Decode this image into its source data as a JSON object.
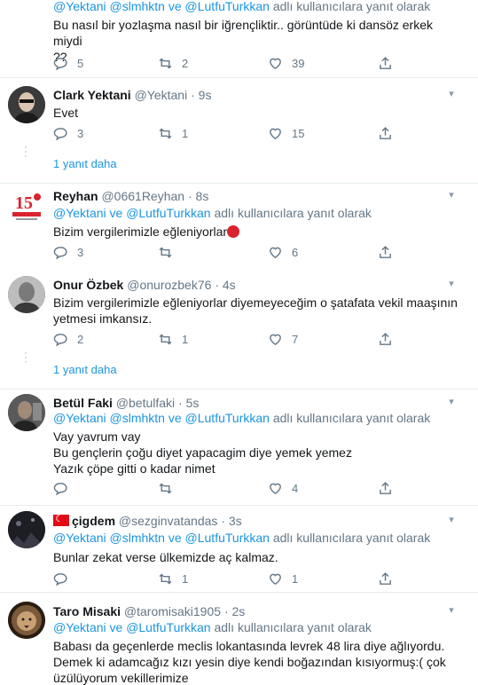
{
  "tweets": [
    {
      "reply_users": "@Yektani @slmhktn ve @LutfuTurkkan",
      "reply_suffix": "adlı kullanıcılara yanıt olarak",
      "text_lines": [
        "Bu nasıl bir yozlaşma nasıl bir iğrençliktir.. görüntüde ki dansöz erkek miydi",
        "??"
      ],
      "replies": "5",
      "retweets": "2",
      "likes": "39"
    },
    {
      "name": "Clark Yektani",
      "handle": "@Yektani",
      "time": "9s",
      "text_lines": [
        "Evet"
      ],
      "replies": "3",
      "retweets": "1",
      "likes": "15",
      "more_replies": "1 yanıt daha"
    },
    {
      "name": "Reyhan",
      "handle": "@0661Reyhan",
      "time": "8s",
      "reply_users": "@Yektani ve @LutfuTurkkan",
      "reply_suffix": "adlı kullanıcılara yanıt olarak",
      "text_lines": [
        "Bizim vergilerimizle eğleniyorlar"
      ],
      "replies": "3",
      "retweets": "",
      "likes": "6"
    },
    {
      "name": "Onur Özbek",
      "handle": "@onurozbek76",
      "time": "4s",
      "text_lines": [
        "Bizim vergilerimizle eğleniyorlar diyemeyeceğim o şatafata vekil maaşının",
        "yetmesi imkansız."
      ],
      "replies": "2",
      "retweets": "1",
      "likes": "7",
      "more_replies": "1 yanıt daha"
    },
    {
      "name": "Betül Faki",
      "handle": "@betulfaki",
      "time": "5s",
      "reply_users": "@Yektani @slmhktn ve @LutfuTurkkan",
      "reply_suffix": "adlı kullanıcılara yanıt olarak",
      "text_lines": [
        "Vay yavrum vay",
        "Bu gençlerin çoğu  diyet yapacagim diye yemek yemez",
        "Yazık çöpe gitti o kadar nimet"
      ],
      "replies": "",
      "retweets": "",
      "likes": "4"
    },
    {
      "name": "çigdem",
      "handle": "@sezginvatandas",
      "time": "3s",
      "reply_users": "@Yektani @slmhktn ve @LutfuTurkkan",
      "reply_suffix": "adlı kullanıcılara yanıt olarak",
      "text_lines": [
        "Bunlar zekat verse ülkemizde aç kalmaz."
      ],
      "replies": "",
      "retweets": "1",
      "likes": "1"
    },
    {
      "name": "Taro Misaki",
      "handle": "@taromisaki1905",
      "time": "2s",
      "reply_users": "@Yektani ve @LutfuTurkkan",
      "reply_suffix": "adlı kullanıcılara yanıt olarak",
      "text_lines": [
        "Babası da geçenlerde meclis lokantasında levrek 48 lira diye ağlıyordu.",
        "Demek ki adamcağız kızı yesin diye kendi boğazından kısıyormuş:( çok",
        "üzülüyorum vekillerimize"
      ]
    }
  ],
  "colors": {
    "link": "#1b95e0",
    "muted": "#657786",
    "divider": "#e6ecf0"
  },
  "icons": [
    "reply-icon",
    "retweet-icon",
    "like-icon",
    "share-icon",
    "chevron-down-icon"
  ]
}
